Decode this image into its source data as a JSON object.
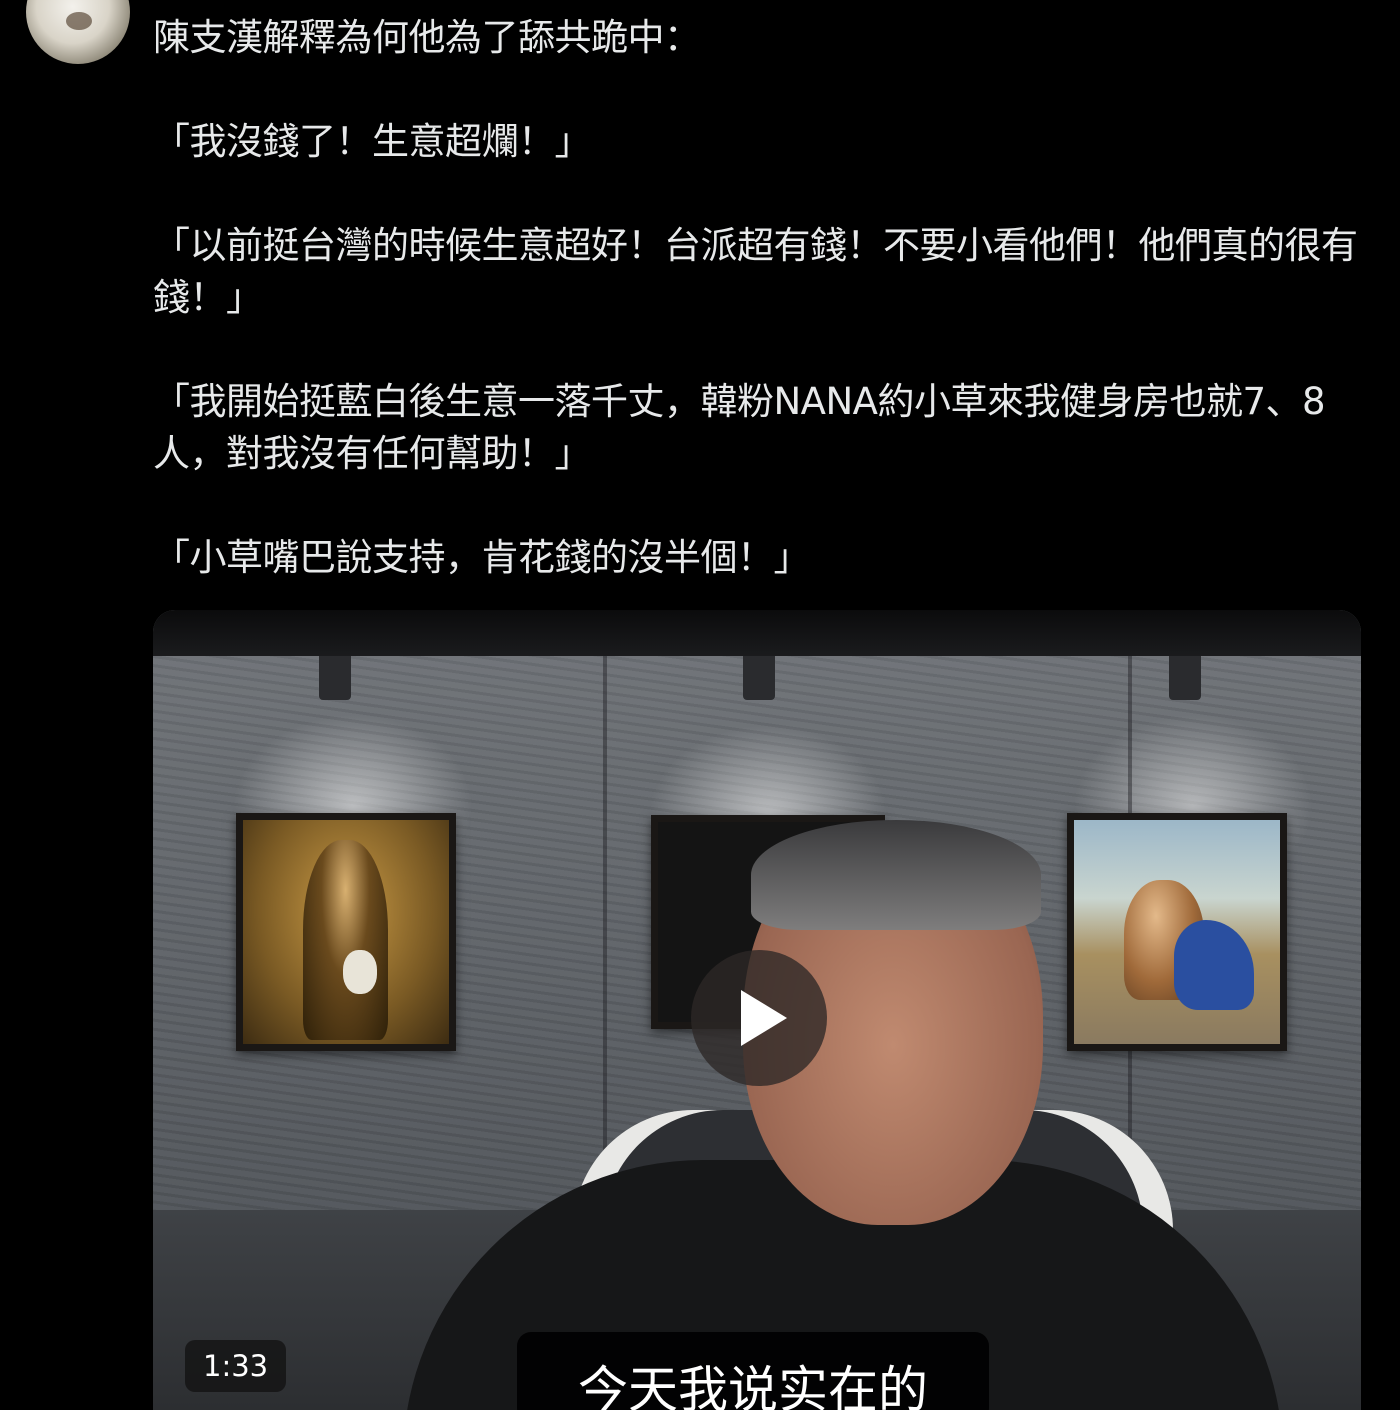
{
  "tweet": {
    "intro": "陳支漢解釋為何他為了舔共跪中：",
    "quote1": "「我沒錢了！生意超爛！」",
    "quote2": "「以前挺台灣的時候生意超好！台派超有錢！不要小看他們！他們真的很有錢！」",
    "quote3": "「我開始挺藍白後生意一落千丈，韓粉NANA約小草來我健身房也就7、8人，對我沒有任何幫助！」",
    "quote4": "「小草嘴巴說支持，肯花錢的沒半個！」"
  },
  "video": {
    "duration": "1:33",
    "subtitle": "今天我说实在的",
    "play_icon": "play-icon"
  },
  "colors": {
    "background": "#000000",
    "text": "#e7e9ea"
  }
}
